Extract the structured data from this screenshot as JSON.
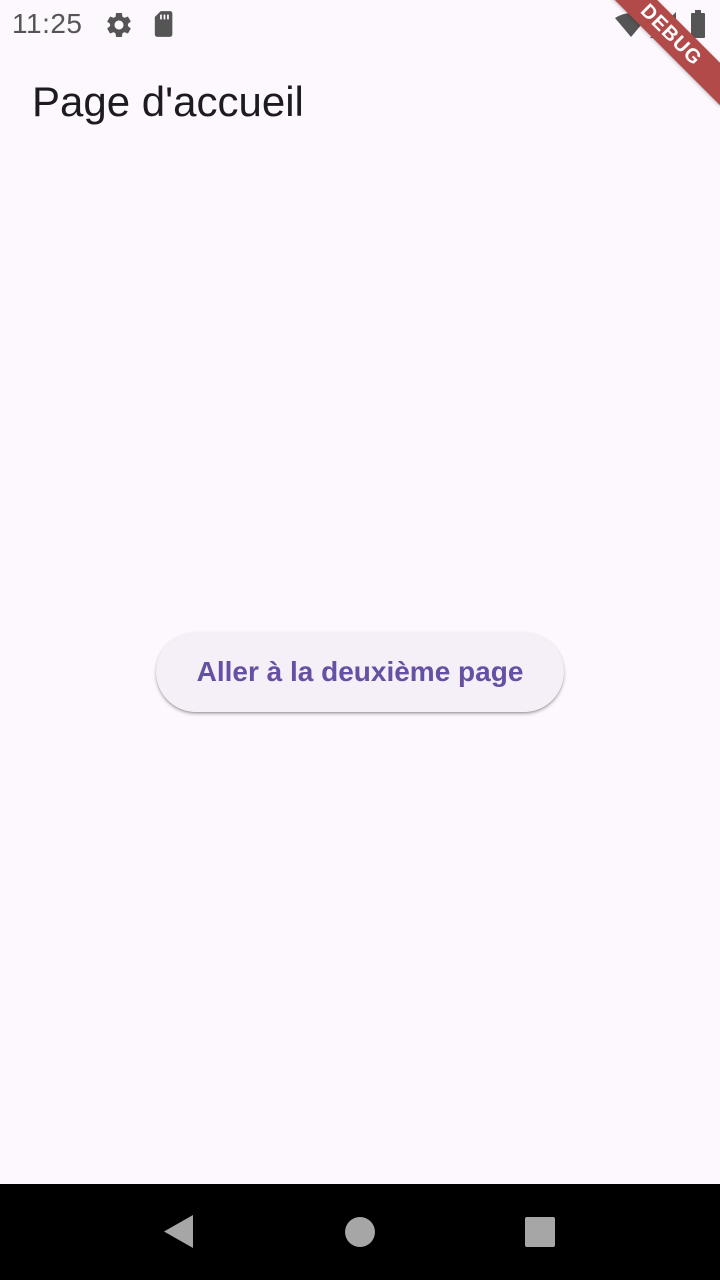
{
  "status_bar": {
    "time": "11:25",
    "left_icons": [
      "settings-icon",
      "sd-card-icon"
    ],
    "right_icons": [
      "wifi-icon",
      "signal-icon",
      "battery-icon"
    ]
  },
  "debug_banner": {
    "label": "DEBUG",
    "color": "#b24a4a"
  },
  "app_bar": {
    "title": "Page d'accueil"
  },
  "main": {
    "button_label": "Aller à la deuxième page"
  },
  "nav_bar": {
    "buttons": [
      "back-icon",
      "home-icon",
      "recents-icon"
    ]
  },
  "colors": {
    "background": "#fdf7fe",
    "button_text": "#6650a4",
    "button_bg": "#f5eff7",
    "title": "#1d1b20"
  }
}
